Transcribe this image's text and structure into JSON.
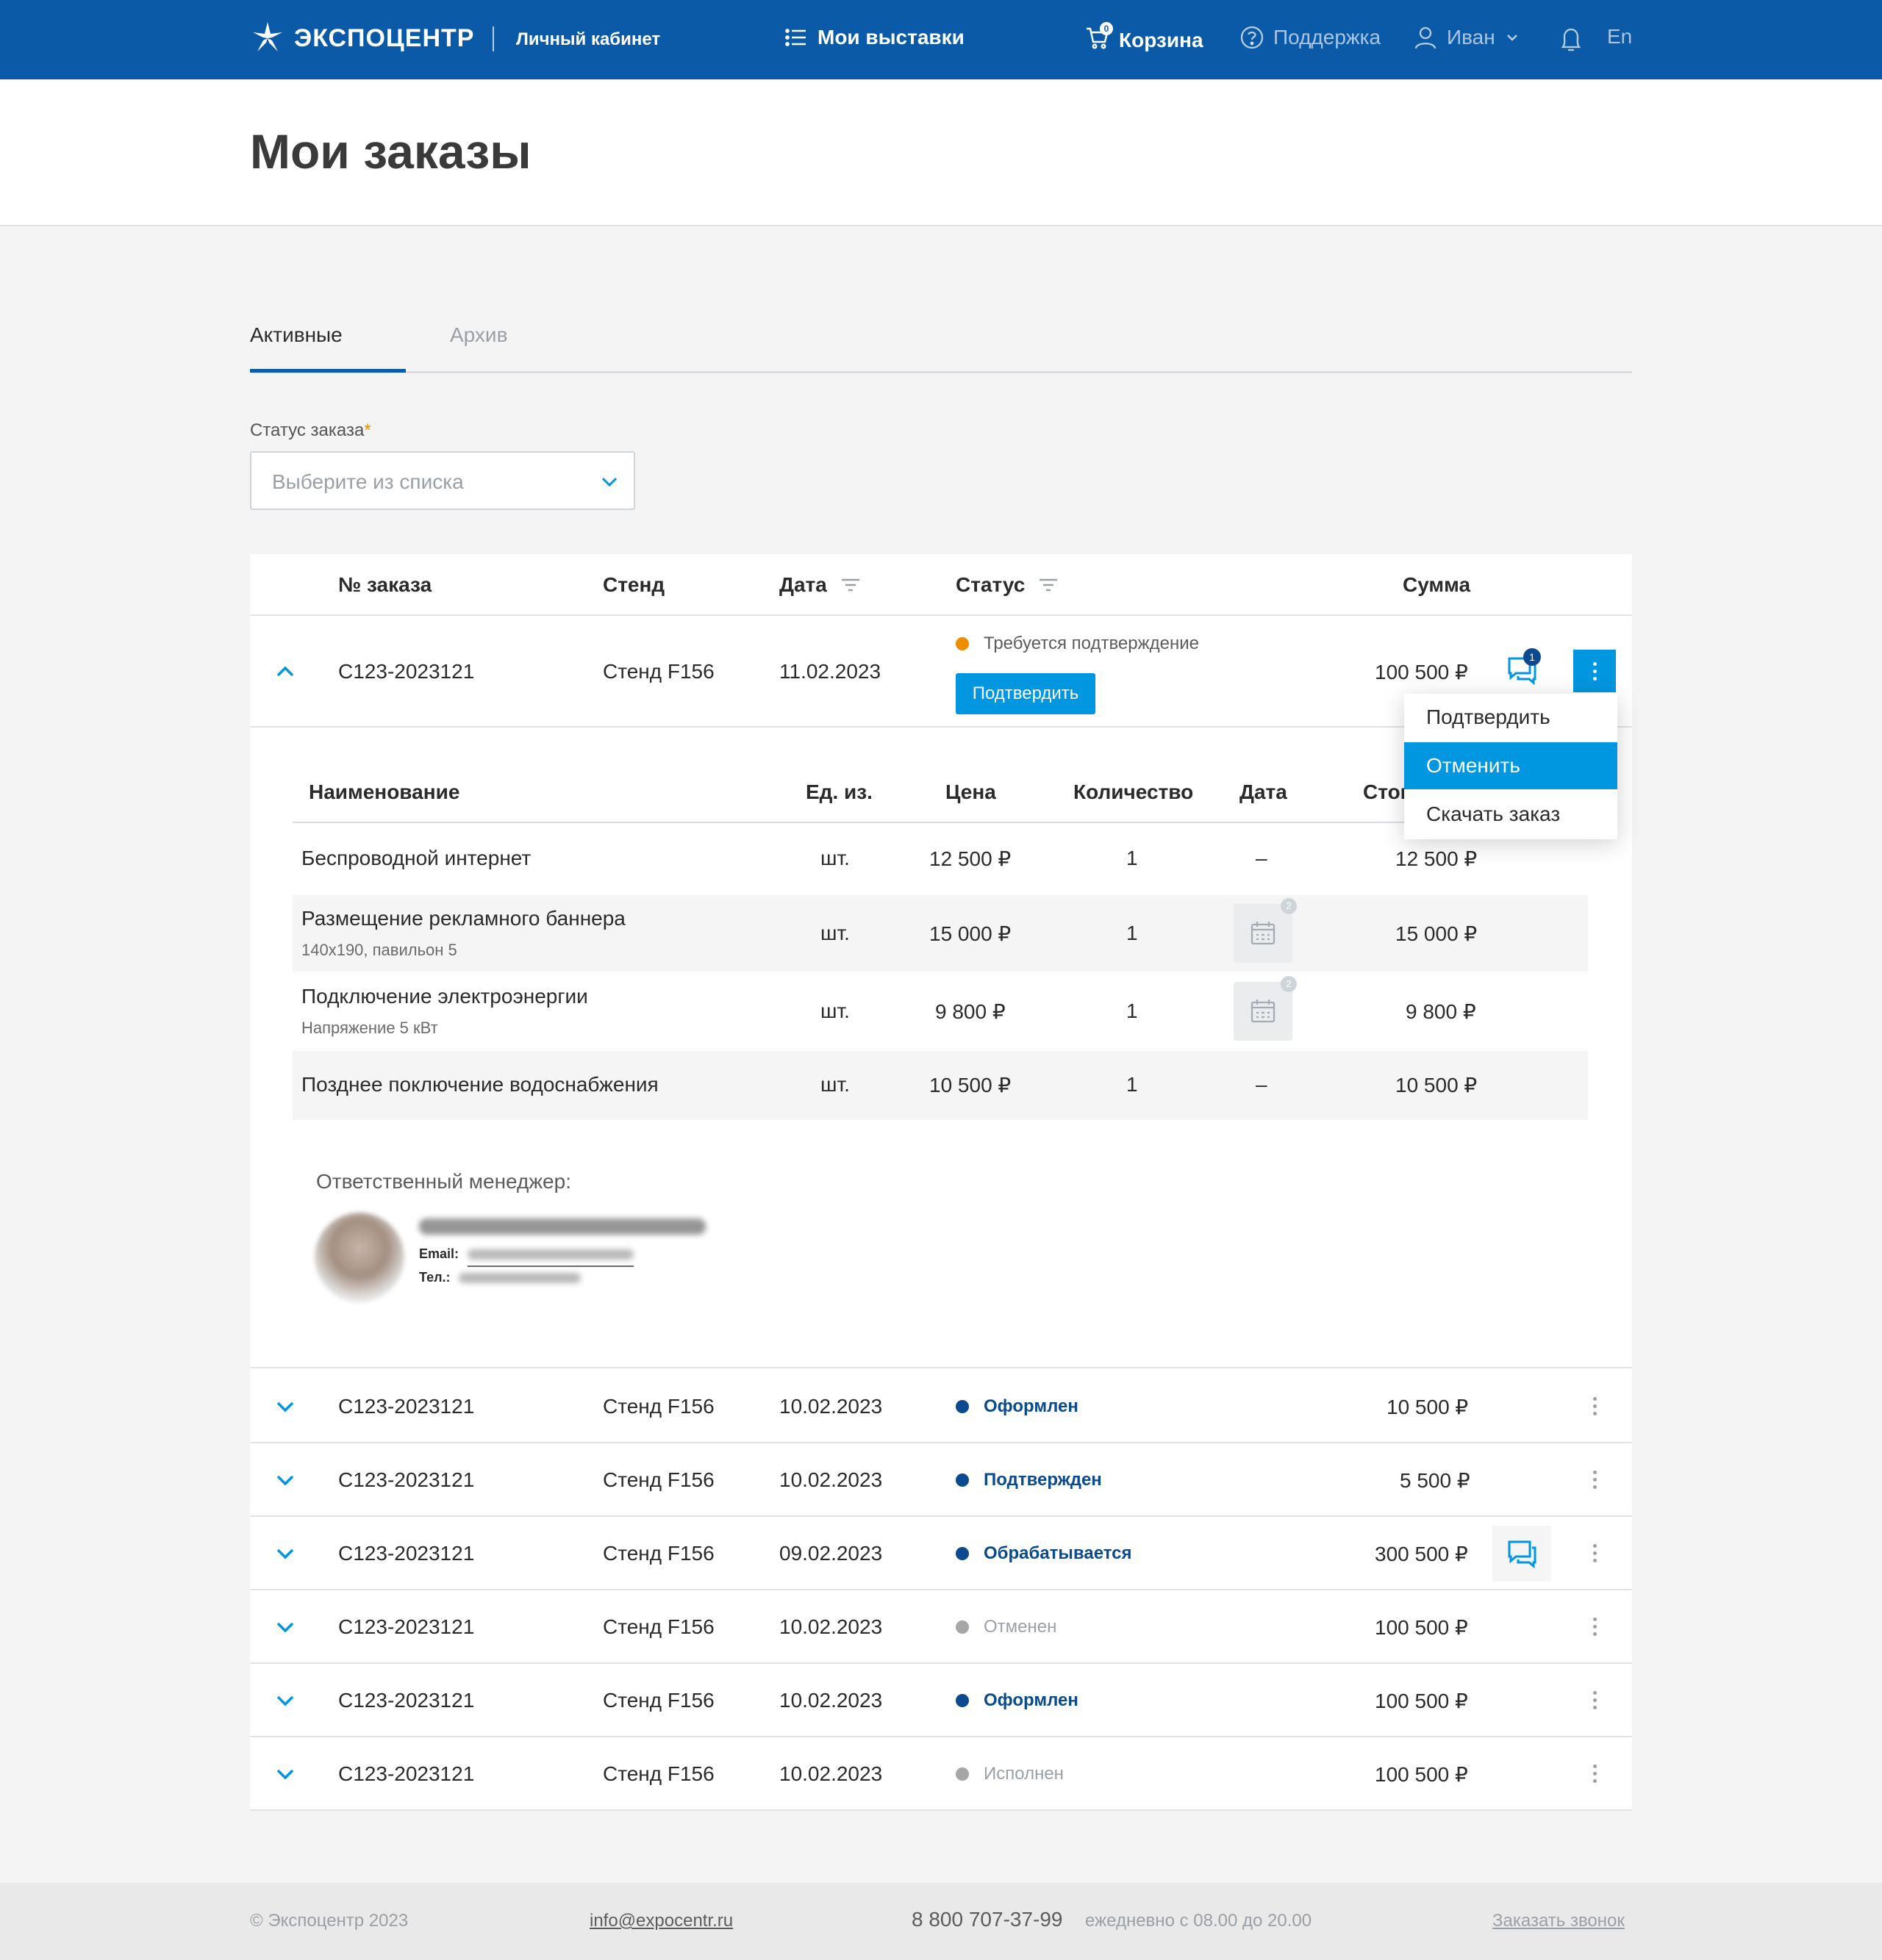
{
  "header": {
    "brand": "ЭКСПОЦЕНТР",
    "cabinet": "Личный кабинет",
    "nav": {
      "exhibitions": "Мои выставки",
      "cart": "Корзина",
      "cart_count": "0",
      "support": "Поддержка",
      "user": "Иван",
      "lang": "En"
    }
  },
  "page": {
    "title": "Мои заказы"
  },
  "tabs": {
    "active": "Активные",
    "archive": "Архив"
  },
  "filter": {
    "label": "Статус заказа",
    "required_mark": "*",
    "placeholder": "Выберите из списка"
  },
  "table": {
    "headers": {
      "number": "№ заказа",
      "stand": "Стенд",
      "date": "Дата",
      "status": "Статус",
      "sum": "Сумма"
    },
    "orders": [
      {
        "number": "С123-2023121",
        "stand": "Стенд F156",
        "date": "11.02.2023",
        "status": "Требуется подтверждение",
        "sum": "100 500 ₽",
        "chat_count": "1"
      },
      {
        "number": "С123-2023121",
        "stand": "Стенд F156",
        "date": "10.02.2023",
        "status": "Оформлен",
        "sum": "10 500 ₽"
      },
      {
        "number": "С123-2023121",
        "stand": "Стенд F156",
        "date": "10.02.2023",
        "status": "Подтвержден",
        "sum": "5 500 ₽"
      },
      {
        "number": "С123-2023121",
        "stand": "Стенд F156",
        "date": "09.02.2023",
        "status": "Обрабатывается",
        "sum": "300 500 ₽"
      },
      {
        "number": "С123-2023121",
        "stand": "Стенд F156",
        "date": "10.02.2023",
        "status": "Отменен",
        "sum": "100 500 ₽"
      },
      {
        "number": "С123-2023121",
        "stand": "Стенд F156",
        "date": "10.02.2023",
        "status": "Оформлен",
        "sum": "100 500 ₽"
      },
      {
        "number": "С123-2023121",
        "stand": "Стенд F156",
        "date": "10.02.2023",
        "status": "Исполнен",
        "sum": "100 500 ₽"
      }
    ],
    "confirm_button": "Подтвердить"
  },
  "details": {
    "headers": {
      "name": "Наименование",
      "unit": "Ед. из.",
      "price": "Цена",
      "qty": "Количество",
      "date": "Дата",
      "cost": "Стоимость"
    },
    "items": [
      {
        "name": "Беспроводной интернет",
        "sub": "",
        "unit": "шт.",
        "price": "12 500 ₽",
        "qty": "1",
        "date": "–",
        "cost": "12 500 ₽"
      },
      {
        "name": "Размещение рекламного баннера",
        "sub": "140х190, павильон 5",
        "unit": "шт.",
        "price": "15 000 ₽",
        "qty": "1",
        "date_badge": "2",
        "cost": "15 000 ₽"
      },
      {
        "name": "Подключение электроэнергии",
        "sub": "Напряжение 5 кВт",
        "unit": "шт.",
        "price": "9 800 ₽",
        "qty": "1",
        "date_badge": "2",
        "cost": "9 800 ₽"
      },
      {
        "name": "Позднее поключение водоснабжения",
        "sub": "",
        "unit": "шт.",
        "price": "10 500 ₽",
        "qty": "1",
        "date": "–",
        "cost": "10 500 ₽"
      }
    ],
    "manager": {
      "label": "Ответственный менеджер:",
      "email_label": "Email:",
      "phone_label": "Тел.:"
    }
  },
  "menu": {
    "confirm": "Подтвердить",
    "cancel": "Отменить",
    "download": "Скачать заказ"
  },
  "footer": {
    "copyright": "© Экспоцентр 2023",
    "email": "info@expocentr.ru",
    "phone": "8 800 707-37-99",
    "hours": "ежедневно с 08.00 до 20.00",
    "callback": "Заказать звонок"
  },
  "colors": {
    "brand": "#0b5aa8",
    "accent": "#0096e0",
    "status_pending": "#f08c00",
    "status_active": "#0b4a8f",
    "status_gray": "#a6a6a6"
  }
}
